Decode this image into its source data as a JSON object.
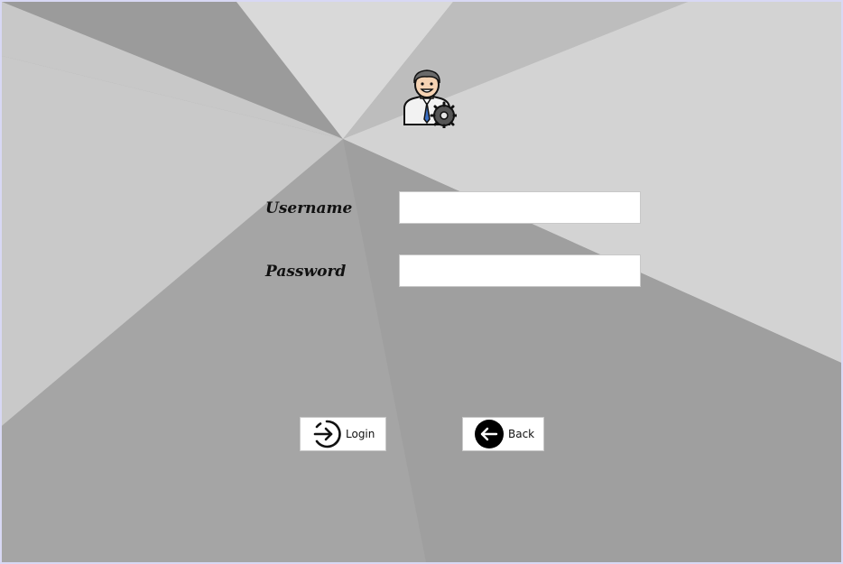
{
  "form": {
    "username_label": "Username",
    "password_label": "Password",
    "username_value": "",
    "password_value": ""
  },
  "buttons": {
    "login_label": "Login",
    "back_label": "Back"
  },
  "icons": {
    "avatar": "user-settings-icon",
    "login": "login-arrow-icon",
    "back": "back-arrow-icon"
  }
}
